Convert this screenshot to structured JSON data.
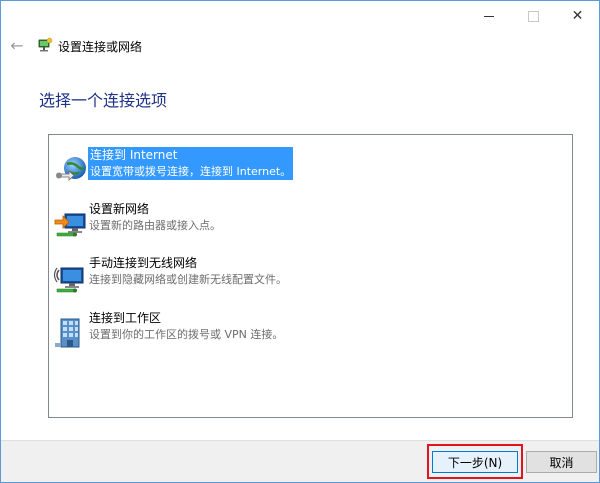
{
  "window": {
    "title": "设置连接或网络",
    "minimize_icon": "minimize-icon",
    "maximize_icon": "maximize-icon",
    "close_icon": "close-icon",
    "close_glyph": "✕",
    "back_icon": "back-arrow-icon",
    "back_glyph": "←"
  },
  "main": {
    "heading": "选择一个连接选项"
  },
  "options": [
    {
      "title": "连接到 Internet",
      "description": "设置宽带或拨号连接，连接到 Internet。",
      "icon": "globe-network-icon",
      "selected": true
    },
    {
      "title": "设置新网络",
      "description": "设置新的路由器或接入点。",
      "icon": "new-network-icon",
      "selected": false
    },
    {
      "title": "手动连接到无线网络",
      "description": "连接到隐藏网络或创建新无线配置文件。",
      "icon": "wireless-network-icon",
      "selected": false
    },
    {
      "title": "连接到工作区",
      "description": "设置到你的工作区的拨号或 VPN 连接。",
      "icon": "workplace-icon",
      "selected": false
    }
  ],
  "footer": {
    "next_label": "下一步(N)",
    "cancel_label": "取消"
  },
  "colors": {
    "selection": "#3399ff",
    "heading": "#1e3287",
    "highlight_box": "#e0141e"
  }
}
